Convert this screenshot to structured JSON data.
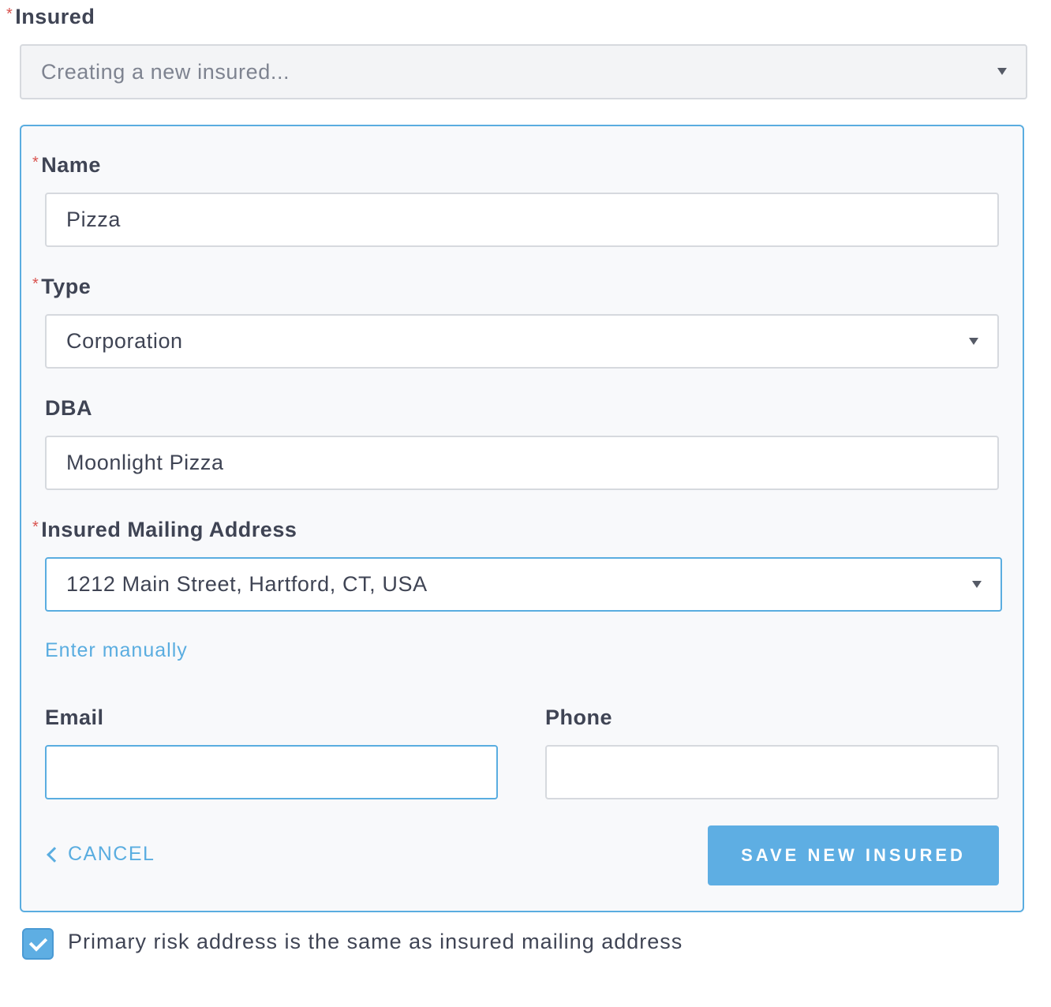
{
  "insured": {
    "label": "Insured",
    "required_marker": "*",
    "select_value": "Creating a new insured..."
  },
  "form": {
    "name": {
      "label": "Name",
      "required_marker": "*",
      "value": "Pizza"
    },
    "type": {
      "label": "Type",
      "required_marker": "*",
      "value": "Corporation"
    },
    "dba": {
      "label": "DBA",
      "value": "Moonlight Pizza"
    },
    "mailing_address": {
      "label": "Insured Mailing Address",
      "required_marker": "*",
      "value": "1212 Main Street, Hartford, CT, USA",
      "enter_manually_link": "Enter manually"
    },
    "email": {
      "label": "Email",
      "value": ""
    },
    "phone": {
      "label": "Phone",
      "value": ""
    },
    "cancel_label": "CANCEL",
    "save_label": "SAVE NEW INSURED"
  },
  "primary_risk": {
    "checked": true,
    "label": "Primary risk address is the same as insured mailing address"
  },
  "colors": {
    "accent": "#5eaee3",
    "required": "#d9534f",
    "text": "#3f4454",
    "panel_bg": "#f8f9fb",
    "border": "#d6d9de"
  }
}
